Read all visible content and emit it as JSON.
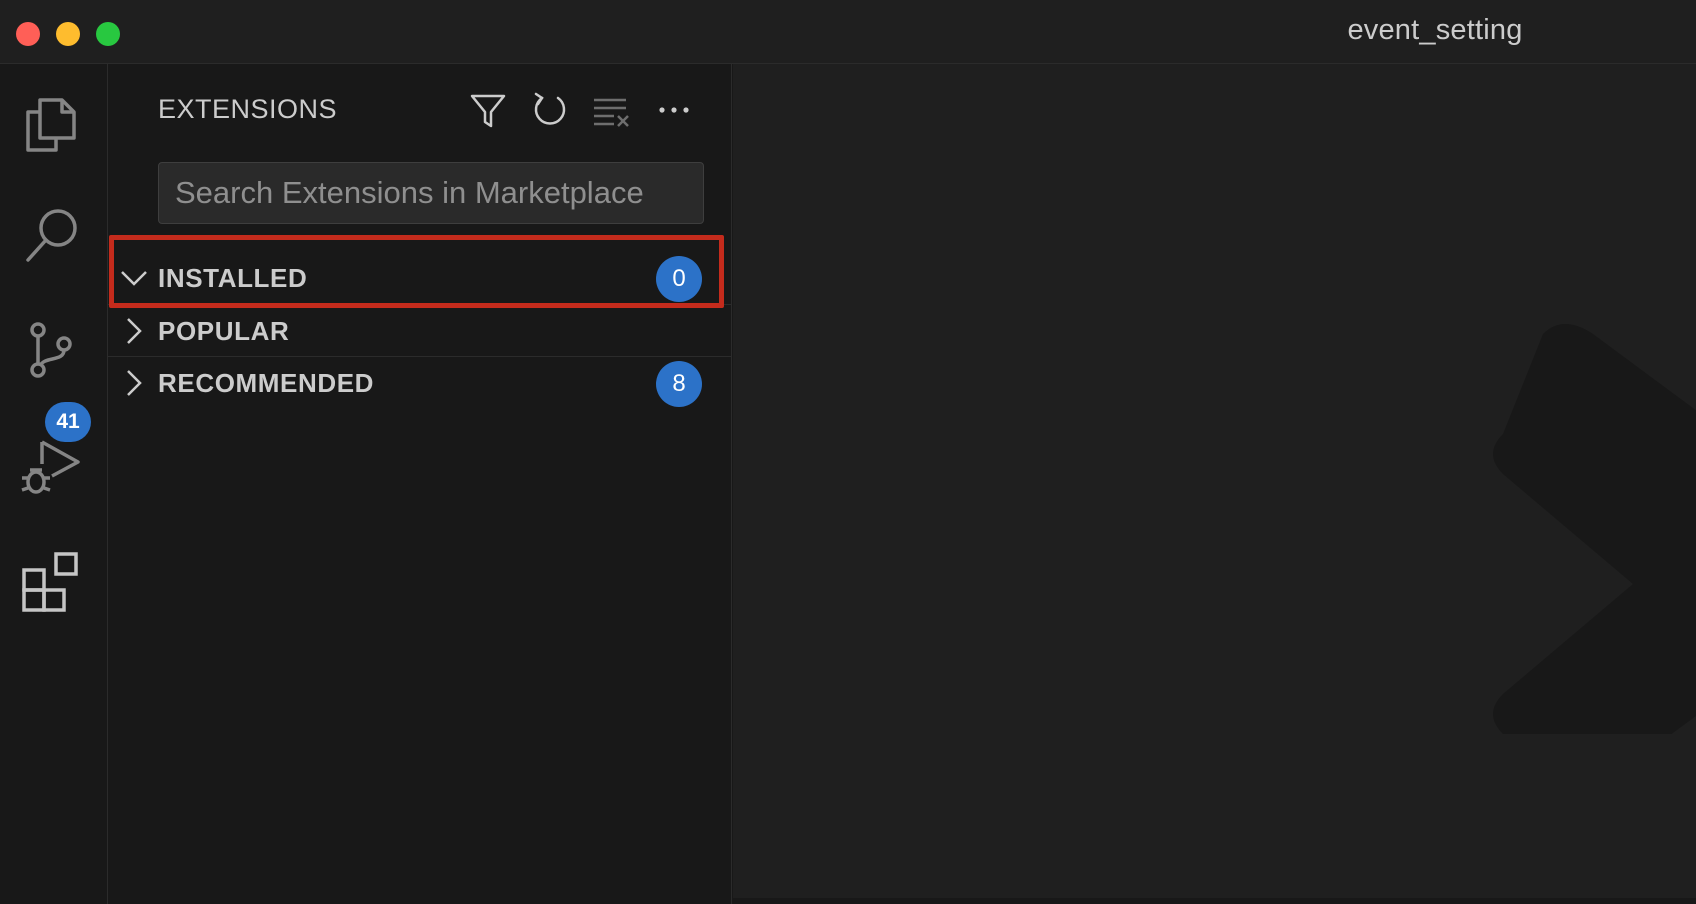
{
  "window": {
    "title": "event_setting"
  },
  "activity_bar": {
    "items": [
      {
        "name": "explorer",
        "icon": "files-icon"
      },
      {
        "name": "search",
        "icon": "search-icon"
      },
      {
        "name": "source-control",
        "icon": "source-control-icon",
        "badge": "41"
      },
      {
        "name": "run-and-debug",
        "icon": "run-debug-icon"
      },
      {
        "name": "extensions",
        "icon": "extensions-icon"
      }
    ]
  },
  "sidebar": {
    "title": "EXTENSIONS",
    "actions": [
      {
        "icon": "filter-icon"
      },
      {
        "icon": "refresh-icon"
      },
      {
        "icon": "clear-extensions-icon"
      },
      {
        "icon": "more-actions-icon"
      }
    ],
    "search": {
      "placeholder": "Search Extensions in Marketplace",
      "value": ""
    },
    "sections": [
      {
        "label": "INSTALLED",
        "expanded": true,
        "count": "0"
      },
      {
        "label": "POPULAR",
        "expanded": false
      },
      {
        "label": "RECOMMENDED",
        "expanded": false,
        "count": "8"
      }
    ]
  },
  "colors": {
    "accent": "#2c72c8",
    "highlight": "#c42b1c",
    "background": "#181818",
    "editor_background": "#1f1f1f"
  }
}
